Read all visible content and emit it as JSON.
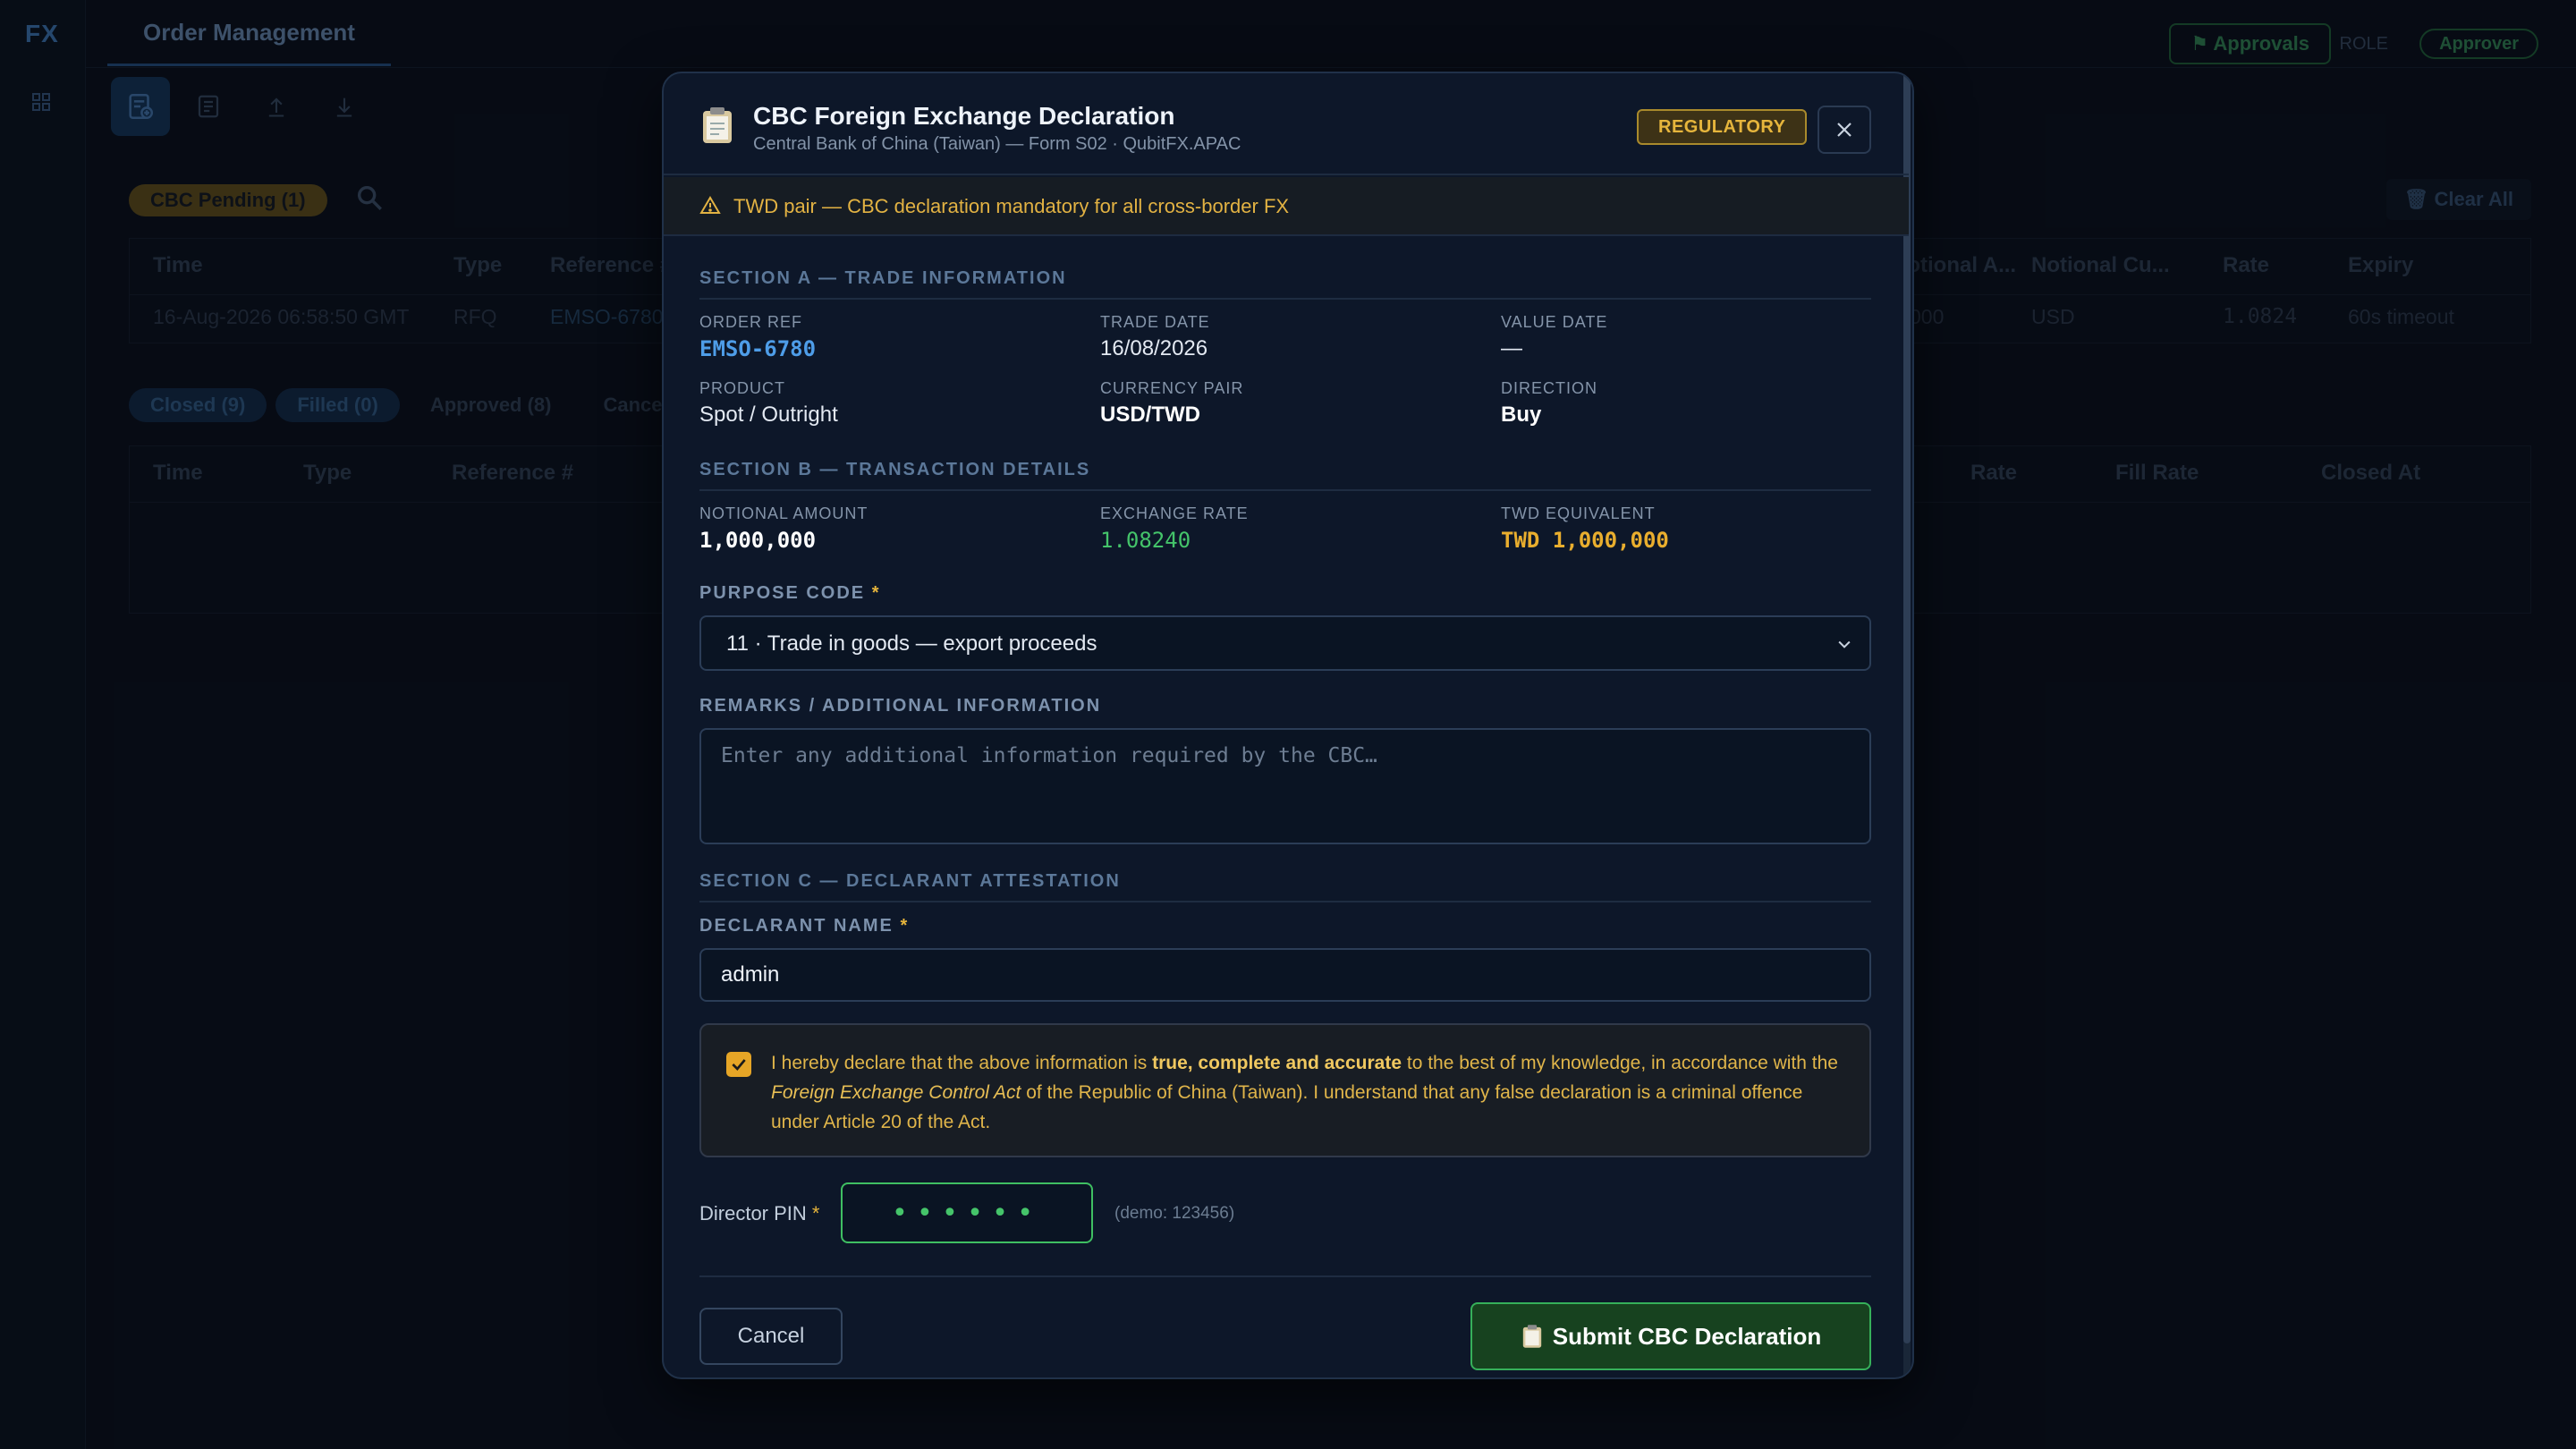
{
  "app": {
    "brand": "FX",
    "tab": "Order Management",
    "approvals_label": "Approvals",
    "role_label": "ROLE",
    "role_value": "Approver",
    "pending_label": "CBC Pending (1)",
    "clear_all": "Clear All",
    "pending_table": {
      "headers": [
        "Time",
        "Type",
        "Reference #",
        "Notional A...",
        "Notional Cu...",
        "Rate",
        "Expiry"
      ],
      "row": [
        "16-Aug-2026 06:58:50 GMT",
        "RFQ",
        "EMSO-6780",
        "000",
        "USD",
        "1.0824",
        "60s timeout"
      ]
    },
    "filters": [
      "Closed (9)",
      "Filled (0)",
      "Approved (8)",
      "Cance"
    ],
    "closed_table_headers": [
      "Time",
      "Type",
      "Reference #",
      "Rate",
      "Fill Rate",
      "Closed At"
    ]
  },
  "modal": {
    "title": "CBC Foreign Exchange Declaration",
    "subtitle": "Central Bank of China (Taiwan) — Form S02 · QubitFX.APAC",
    "badge": "REGULATORY",
    "warning": "TWD pair — CBC declaration mandatory for all cross-border FX",
    "section_a": {
      "title": "SECTION A — TRADE INFORMATION",
      "order_ref_label": "ORDER REF",
      "order_ref": "EMSO-6780",
      "trade_date_label": "TRADE DATE",
      "trade_date": "16/08/2026",
      "value_date_label": "VALUE DATE",
      "value_date": "—",
      "product_label": "PRODUCT",
      "product": "Spot / Outright",
      "pair_label": "CURRENCY PAIR",
      "pair": "USD/TWD",
      "direction_label": "DIRECTION",
      "direction": "Buy"
    },
    "section_b": {
      "title": "SECTION B — TRANSACTION DETAILS",
      "notional_label": "NOTIONAL AMOUNT",
      "notional": "1,000,000",
      "rate_label": "EXCHANGE RATE",
      "rate": "1.08240",
      "twd_label": "TWD EQUIVALENT",
      "twd": "TWD 1,000,000",
      "purpose_label": "PURPOSE CODE",
      "purpose_value": "11 · Trade in goods — export proceeds",
      "remarks_label": "REMARKS / ADDITIONAL INFORMATION",
      "remarks_placeholder": "Enter any additional information required by the CBC…",
      "remarks_value": ""
    },
    "section_c": {
      "title": "SECTION C — DECLARANT ATTESTATION",
      "declarant_label": "DECLARANT NAME",
      "declarant_value": "admin",
      "attest_checked": true,
      "attest_1": "I hereby declare that the above information is ",
      "attest_bold": "true, complete and accurate",
      "attest_2": " to the best of my knowledge, in accordance with the ",
      "attest_italic": "Foreign Exchange Control Act",
      "attest_3": " of the Republic of China (Taiwan). I understand that any false declaration is a criminal offence under Article 20 of the Act."
    },
    "pin": {
      "label": "Director PIN",
      "dots": "••••••",
      "hint": "(demo: 123456)"
    },
    "required_mark": "*",
    "cancel": "Cancel",
    "submit": "Submit CBC Declaration"
  },
  "colors": {
    "accent_gold": "#e6b53c",
    "accent_green": "#45c46a",
    "link_blue": "#4e9de8"
  }
}
